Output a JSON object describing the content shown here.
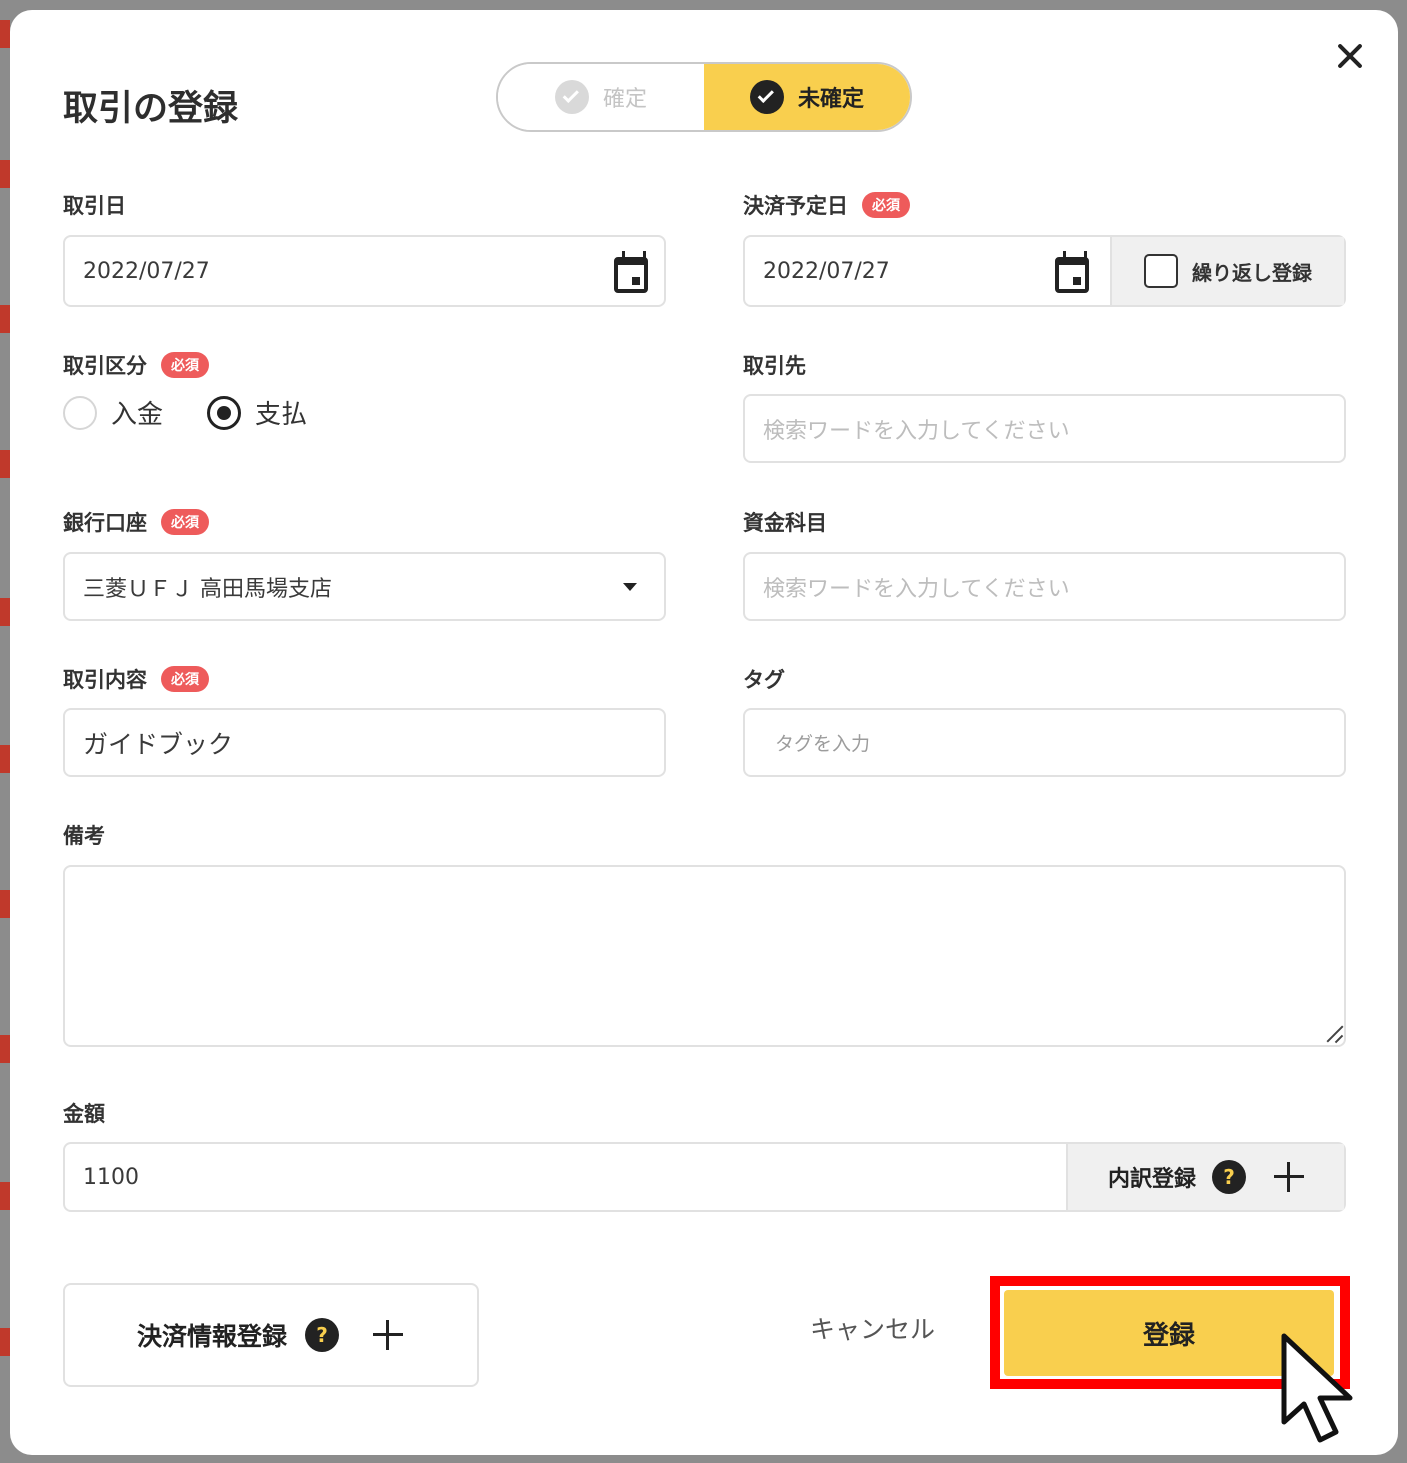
{
  "dialog": {
    "title": "取引の登録",
    "close_label": "×"
  },
  "status_toggle": {
    "confirmed_label": "確定",
    "unconfirmed_label": "未確定",
    "selected": "未確定"
  },
  "required_badge": "必須",
  "fields": {
    "transaction_date": {
      "label": "取引日",
      "value": "2022/07/27"
    },
    "settlement_date": {
      "label": "決済予定日",
      "value": "2022/07/27",
      "repeat_label": "繰り返し登録",
      "repeat_checked": false
    },
    "transaction_type": {
      "label": "取引区分",
      "options": [
        "入金",
        "支払"
      ],
      "selected": "支払"
    },
    "partner": {
      "label": "取引先",
      "placeholder": "検索ワードを入力してください"
    },
    "bank_account": {
      "label": "銀行口座",
      "value": "三菱ＵＦＪ 高田馬場支店"
    },
    "fund_item": {
      "label": "資金科目",
      "placeholder": "検索ワードを入力してください"
    },
    "description": {
      "label": "取引内容",
      "value": "ガイドブック"
    },
    "tags": {
      "label": "タグ",
      "placeholder": "タグを入力"
    },
    "notes": {
      "label": "備考",
      "value": ""
    },
    "amount": {
      "label": "金額",
      "value": "1100",
      "detail_label": "内訳登録"
    }
  },
  "footer": {
    "settlement_info_label": "決済情報登録",
    "cancel_label": "キャンセル",
    "submit_label": "登録"
  },
  "colors": {
    "accent": "#f9cf4e",
    "required": "#ee5b5b",
    "highlight": "#ff0000"
  }
}
